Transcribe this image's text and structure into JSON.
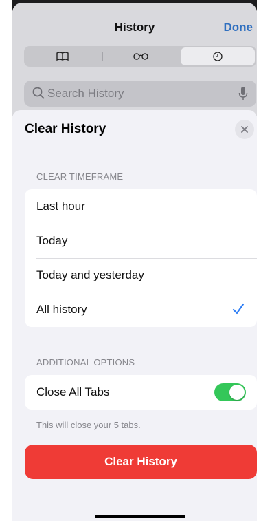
{
  "history_sheet": {
    "title": "History",
    "done_label": "Done",
    "tabs": [
      {
        "icon": "book-icon"
      },
      {
        "icon": "reading-list-icon"
      },
      {
        "icon": "clock-icon"
      }
    ],
    "search_placeholder": "Search History"
  },
  "clear_sheet": {
    "title": "Clear History",
    "timeframe_header": "CLEAR TIMEFRAME",
    "timeframes": [
      {
        "label": "Last hour",
        "selected": false
      },
      {
        "label": "Today",
        "selected": false
      },
      {
        "label": "Today and yesterday",
        "selected": false
      },
      {
        "label": "All history",
        "selected": true
      }
    ],
    "options_header": "ADDITIONAL OPTIONS",
    "close_tabs_label": "Close All Tabs",
    "close_tabs_on": true,
    "close_tabs_note": "This will close your 5 tabs.",
    "clear_button_label": "Clear History"
  },
  "colors": {
    "accent": "#2f6fbf",
    "checkmark": "#2f7ff5",
    "toggle_on": "#34c759",
    "destructive": "#ef3b36"
  }
}
